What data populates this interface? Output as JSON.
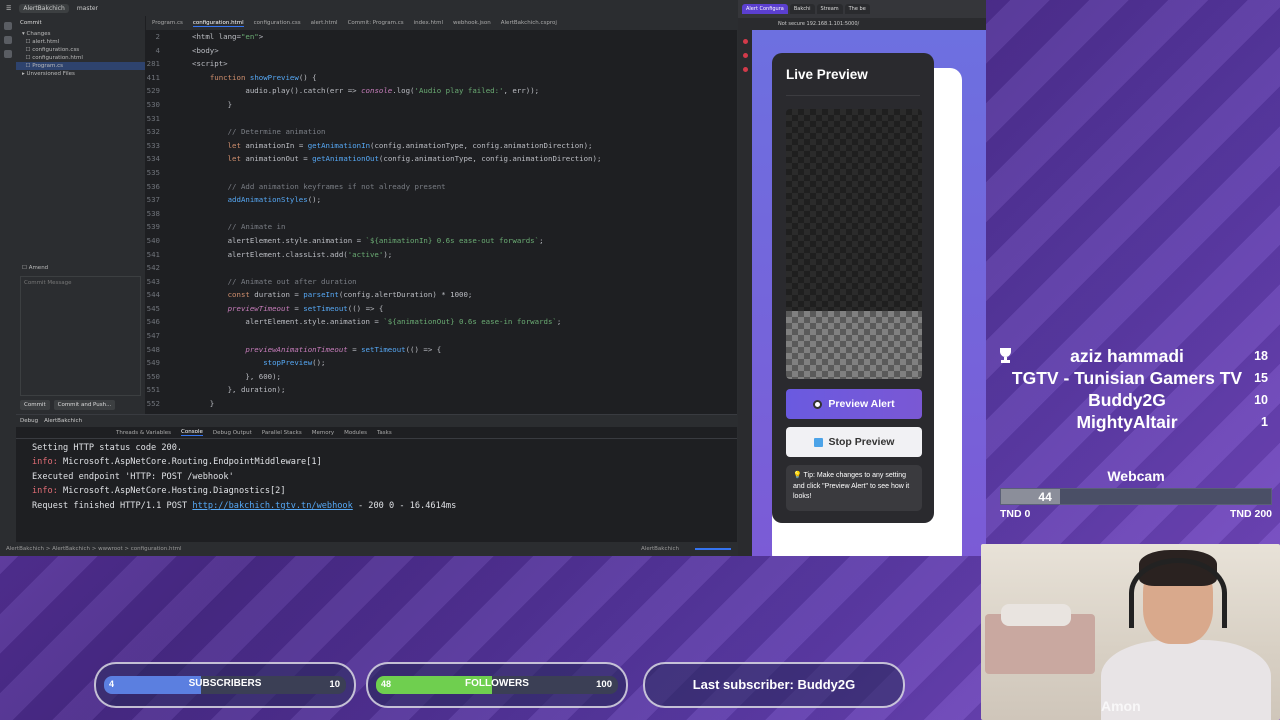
{
  "ide": {
    "branch": "master",
    "project": "AlertBakchich",
    "commit_panel": {
      "title": "Commit",
      "changes_label": "Changes",
      "files": [
        "alert.html",
        "configuration.css",
        "configuration.html",
        "Program.cs"
      ],
      "unversioned_label": "Unversioned Files",
      "amend_label": "Amend",
      "message_placeholder": "Commit Message",
      "commit_button": "Commit",
      "commit_push_button": "Commit and Push..."
    },
    "tabs": [
      "Program.cs",
      "configuration.html",
      "configuration.css",
      "alert.html",
      "Commit: Program.cs",
      "index.html",
      "webhook.json",
      "AlertBakchich.csproj"
    ],
    "active_tab": "configuration.html",
    "code_lines": [
      {
        "n": "2",
        "t": "<html lang=\"en\">"
      },
      {
        "n": "4",
        "t": "<body>"
      },
      {
        "n": "281",
        "t": "<script>"
      },
      {
        "n": "411",
        "t": "    function showPreview() {"
      },
      {
        "n": "529",
        "t": "            audio.play().catch(err => console.log('Audio play failed:', err));"
      },
      {
        "n": "530",
        "t": "        }"
      },
      {
        "n": "531",
        "t": ""
      },
      {
        "n": "532",
        "t": "        // Determine animation"
      },
      {
        "n": "533",
        "t": "        let animationIn = getAnimationIn(config.animationType, config.animationDirection);"
      },
      {
        "n": "534",
        "t": "        let animationOut = getAnimationOut(config.animationType, config.animationDirection);"
      },
      {
        "n": "535",
        "t": ""
      },
      {
        "n": "536",
        "t": "        // Add animation keyframes if not already present"
      },
      {
        "n": "537",
        "t": "        addAnimationStyles();"
      },
      {
        "n": "538",
        "t": ""
      },
      {
        "n": "539",
        "t": "        // Animate in"
      },
      {
        "n": "540",
        "t": "        alertElement.style.animation = `${animationIn} 0.6s ease-out forwards`;"
      },
      {
        "n": "541",
        "t": "        alertElement.classList.add('active');"
      },
      {
        "n": "542",
        "t": ""
      },
      {
        "n": "543",
        "t": "        // Animate out after duration"
      },
      {
        "n": "544",
        "t": "        const duration = parseInt(config.alertDuration) * 1000;"
      },
      {
        "n": "545",
        "t": "        previewTimeout = setTimeout(() => {"
      },
      {
        "n": "546",
        "t": "            alertElement.style.animation = `${animationOut} 0.6s ease-in forwards`;"
      },
      {
        "n": "547",
        "t": ""
      },
      {
        "n": "548",
        "t": "            previewAnimationTimeout = setTimeout(() => {"
      },
      {
        "n": "549",
        "t": "                stopPreview();"
      },
      {
        "n": "550",
        "t": "            }, 600);"
      },
      {
        "n": "551",
        "t": "        }, duration);"
      },
      {
        "n": "552",
        "t": "    }"
      }
    ],
    "debug": {
      "title": "Debug",
      "config": "AlertBakchich",
      "tabs": [
        "Threads & Variables",
        "Console",
        "Debug Output",
        "Parallel Stacks",
        "Memory",
        "Modules",
        "Tasks"
      ],
      "active_tab": "Console",
      "console": [
        {
          "prefix": "",
          "text": "Setting HTTP status code 200."
        },
        {
          "prefix": "info:",
          "text": " Microsoft.AspNetCore.Routing.EndpointMiddleware[1]"
        },
        {
          "prefix": "",
          "text": "Executed endpoint 'HTTP: POST /webhook'"
        },
        {
          "prefix": "info:",
          "text": " Microsoft.AspNetCore.Hosting.Diagnostics[2]"
        }
      ],
      "last_line_pre": "Request finished HTTP/1.1 POST ",
      "last_line_link": "http://bakchich.tgtv.tn/webhook",
      "last_line_post": " - 200 0 - 16.4614ms"
    },
    "status_path": "AlertBakchich  >  AlertBakchich  >  wwwroot  >  configuration.html",
    "status_right": "AlertBakchich"
  },
  "browser": {
    "tabs": [
      "Alert Configura",
      "Bakchi",
      "Stream",
      "The be"
    ],
    "address": "Not secure  192.168.1.101:5000/",
    "preview": {
      "title": "Live Preview",
      "preview_button": "Preview Alert",
      "stop_button": "Stop Preview",
      "tip": "💡 Tip: Make changes to any setting and click \"Preview Alert\" to see how it looks!"
    }
  },
  "overlay": {
    "leaderboard": [
      {
        "name": "aziz hammadi",
        "score": "18"
      },
      {
        "name": "TGTV - Tunisian Gamers TV",
        "score": "15"
      },
      {
        "name": "Buddy2G",
        "score": "10"
      },
      {
        "name": "MightyAltair",
        "score": "1"
      }
    ],
    "goal": {
      "title": "Webcam",
      "current": "44",
      "progress": 0.22,
      "min_label": "TND 0",
      "max_label": "TND 200"
    },
    "subscribers": {
      "label": "SUBSCRIBERS",
      "current": "4",
      "target": "10",
      "progress": 0.4,
      "color": "#5b7fe0"
    },
    "followers": {
      "label": "FOLLOWERS",
      "current": "48",
      "target": "100",
      "progress": 0.48,
      "color": "#6fcf4f"
    },
    "last_subscriber": "Last subscriber: Buddy2G",
    "webcam_watermark": "Amon"
  }
}
